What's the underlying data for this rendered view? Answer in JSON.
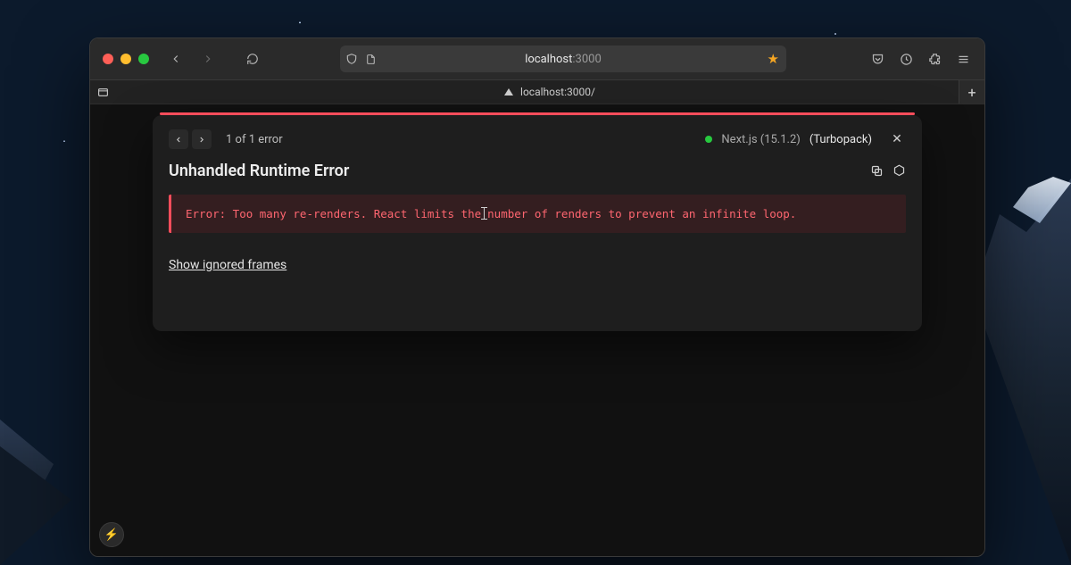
{
  "browser": {
    "url_domain": "localhost",
    "url_port": ":3000",
    "tab_title": "localhost:3000/",
    "bookmark_starred": true
  },
  "overlay": {
    "nav_count": "1 of 1 error",
    "framework": "Next.js (15.1.2)",
    "bundler": "(Turbopack)",
    "title": "Unhandled Runtime Error",
    "message_pre": "Error: Too many re-renders. React limits the",
    "message_post": "number of renders to prevent an infinite loop.",
    "show_frames": "Show ignored frames"
  },
  "dev_indicator_glyph": "⚡"
}
